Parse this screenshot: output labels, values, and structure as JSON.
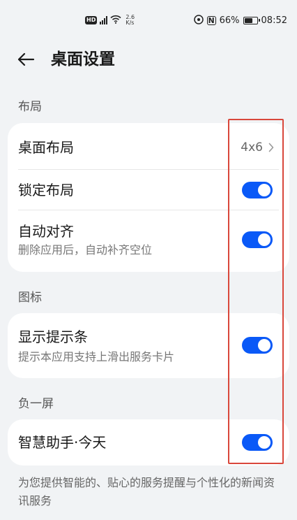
{
  "status_bar": {
    "hd": "HD",
    "network": "4G",
    "speed_value": "2.6",
    "speed_unit": "K/s",
    "battery": "66%",
    "time": "08:52"
  },
  "header": {
    "title": "桌面设置"
  },
  "sections": {
    "layout": {
      "label": "布局",
      "desktop_layout": {
        "title": "桌面布局",
        "value": "4x6"
      },
      "lock_layout": {
        "title": "锁定布局",
        "on": true
      },
      "auto_align": {
        "title": "自动对齐",
        "subtitle": "删除应用后，自动补齐空位",
        "on": true
      }
    },
    "icons": {
      "label": "图标",
      "show_hint_bar": {
        "title": "显示提示条",
        "subtitle": "提示本应用支持上滑出服务卡片",
        "on": true
      }
    },
    "minus_one": {
      "label": "负一屏",
      "smart_assistant": {
        "title": "智慧助手·今天",
        "on": true
      }
    }
  },
  "footer_note": "为您提供智能的、贴心的服务提醒与个性化的新闻资讯服务",
  "colors": {
    "accent": "#0a59f7",
    "background": "#f1f3f5",
    "highlight": "#d9473b"
  }
}
